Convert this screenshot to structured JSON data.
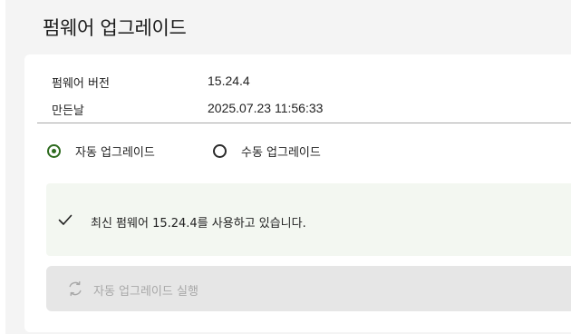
{
  "page": {
    "title": "펌웨어 업그레이드"
  },
  "info": {
    "version_label": "펌웨어 버전",
    "version_value": "15.24.4",
    "date_label": "만든날",
    "date_value": "2025.07.23 11:56:33"
  },
  "upgrade_mode": {
    "options": [
      {
        "label": "자동 업그레이드",
        "selected": true
      },
      {
        "label": "수동 업그레이드",
        "selected": false
      }
    ]
  },
  "status": {
    "icon": "check-icon",
    "message": "최신 펌웨어 15.24.4를 사용하고 있습니다."
  },
  "action": {
    "icon": "refresh-icon",
    "label": "자동 업그레이드 실행",
    "enabled": false
  },
  "colors": {
    "accent": "#2e6b1f",
    "status_bg": "#f3f7f1",
    "disabled_button_bg": "#e6e6e6",
    "disabled_text": "#a8a8a8"
  }
}
